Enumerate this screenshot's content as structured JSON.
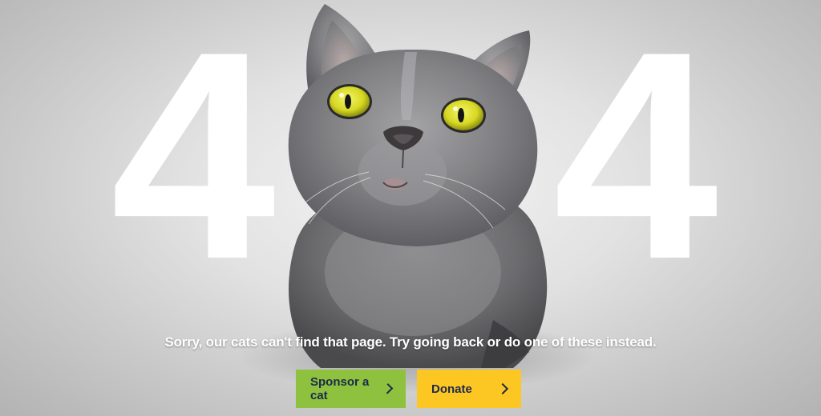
{
  "hero": {
    "digit_left": "4",
    "digit_right": "4"
  },
  "message": "Sorry, our cats can't find that page. Try going back or do one of these instead.",
  "actions": {
    "sponsor_label": "Sponsor a cat",
    "donate_label": "Donate"
  },
  "colors": {
    "sponsor_button": "#8ec13d",
    "donate_button": "#fdc723",
    "button_text": "#1d2a4d",
    "background": "#e2e2e2"
  },
  "icons": {
    "sponsor_arrow": "chevron-right-icon",
    "donate_arrow": "chevron-right-icon"
  }
}
